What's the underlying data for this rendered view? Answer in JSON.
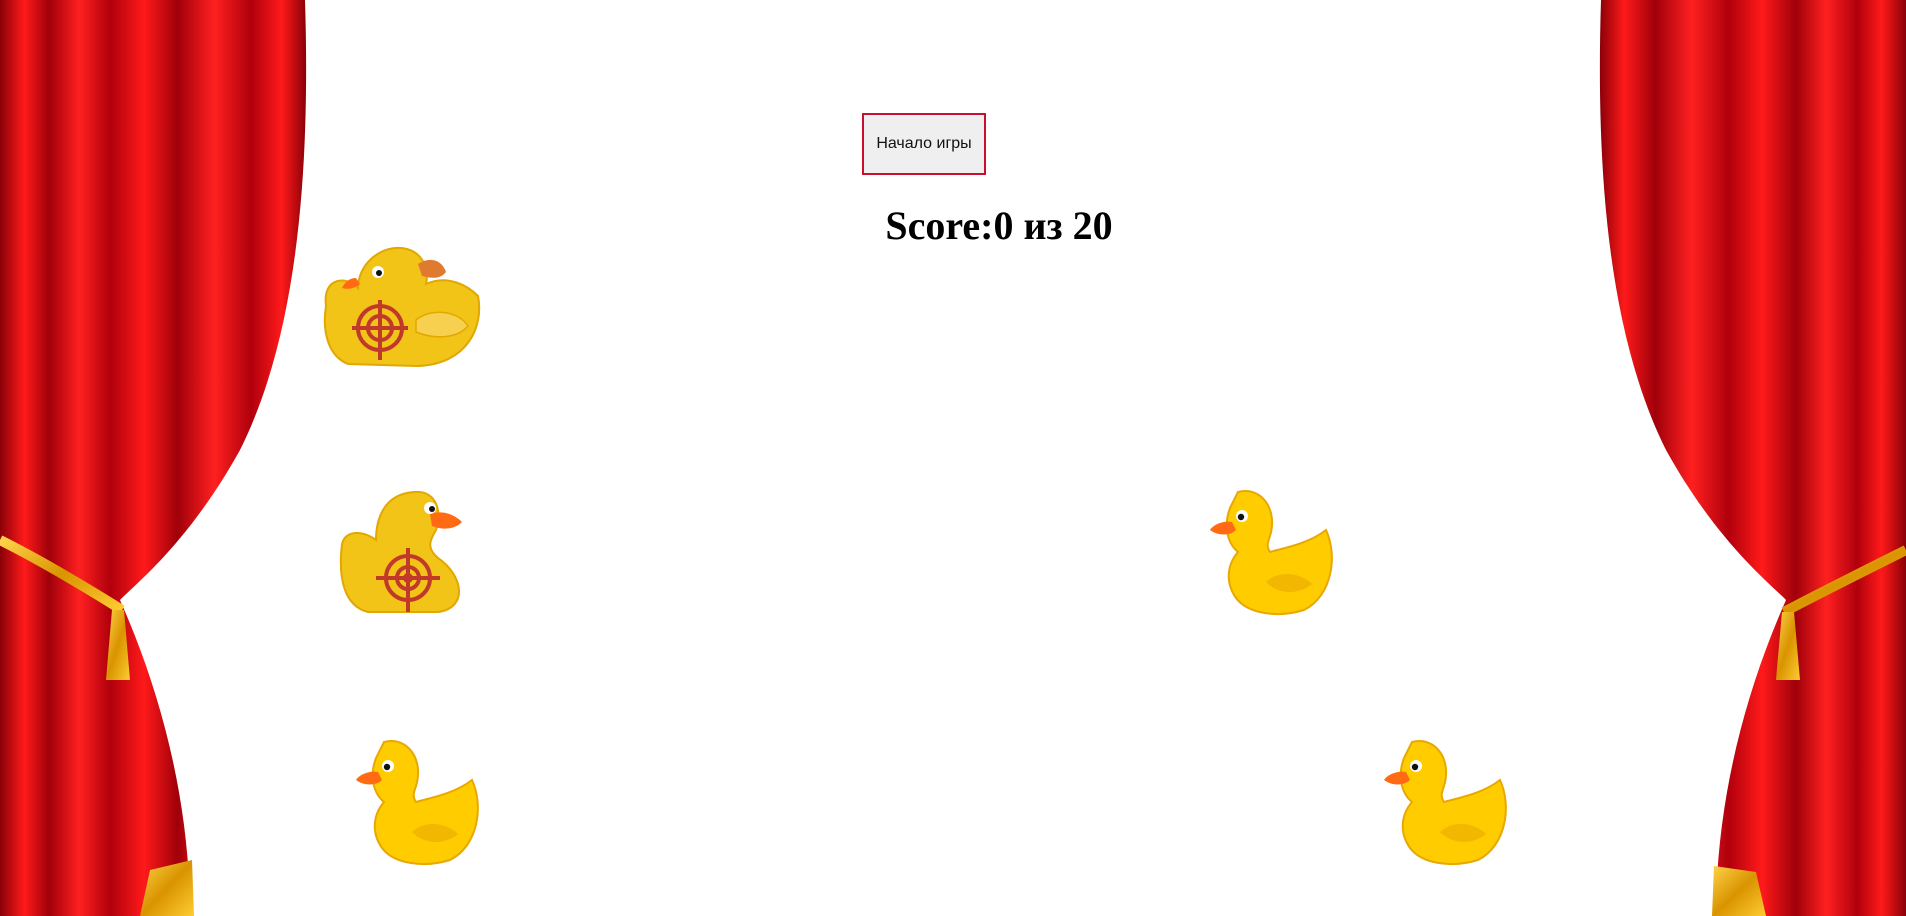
{
  "game": {
    "start_button_label": "Начало игры",
    "score_label": "Score:",
    "score_value": "0",
    "score_separator": " из ",
    "score_total": "20"
  },
  "colors": {
    "curtain_red": "#e0000f",
    "curtain_dark": "#8a0008",
    "rope_gold": "#e0a800",
    "duck_yellow": "#f7c500",
    "duck_beak": "#ff6a13",
    "target_red": "#c0392b"
  },
  "ducks": [
    {
      "id": "duck-1",
      "kind": "target-duck"
    },
    {
      "id": "duck-2",
      "kind": "target-duck"
    },
    {
      "id": "duck-3",
      "kind": "plain-duck"
    },
    {
      "id": "duck-4",
      "kind": "plain-duck"
    },
    {
      "id": "duck-5",
      "kind": "plain-duck"
    }
  ]
}
